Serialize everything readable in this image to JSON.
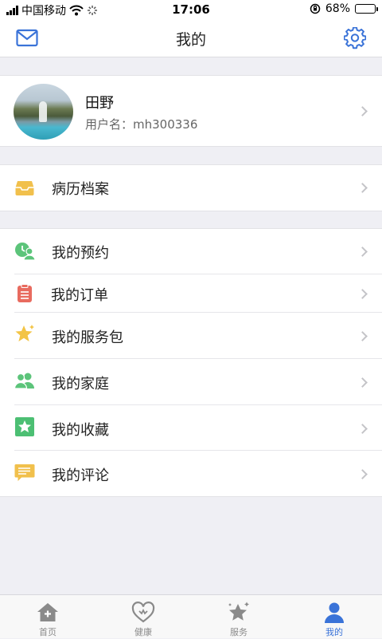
{
  "status_bar": {
    "carrier": "中国移动",
    "time": "17:06",
    "battery": "68%",
    "battery_level": 0.68
  },
  "nav": {
    "title": "我的",
    "left_icon": "mail-icon",
    "right_icon": "gear-icon"
  },
  "profile": {
    "name": "田野",
    "username": "用户名：mh300336"
  },
  "records": {
    "label": "病历档案",
    "icon": "inbox-icon",
    "color": "#f1c04c"
  },
  "menu": [
    {
      "label": "我的预约",
      "icon": "appointment-icon",
      "color": "#5cc47a"
    },
    {
      "label": "我的订单",
      "icon": "clipboard-icon",
      "color": "#e86b5f"
    },
    {
      "label": "我的服务包",
      "icon": "star-icon",
      "color": "#f3c445"
    },
    {
      "label": "我的家庭",
      "icon": "family-icon",
      "color": "#5cc47a"
    },
    {
      "label": "我的收藏",
      "icon": "favorite-icon",
      "color": "#4cbf73"
    },
    {
      "label": "我的评论",
      "icon": "comment-icon",
      "color": "#f1c04c"
    }
  ],
  "tabs": [
    {
      "label": "首页",
      "icon": "home-icon",
      "active": false
    },
    {
      "label": "健康",
      "icon": "heart-icon",
      "active": false
    },
    {
      "label": "服务",
      "icon": "service-star-icon",
      "active": false
    },
    {
      "label": "我的",
      "icon": "person-icon",
      "active": true
    }
  ],
  "colors": {
    "accent": "#3a73d8",
    "background": "#efeff4"
  }
}
